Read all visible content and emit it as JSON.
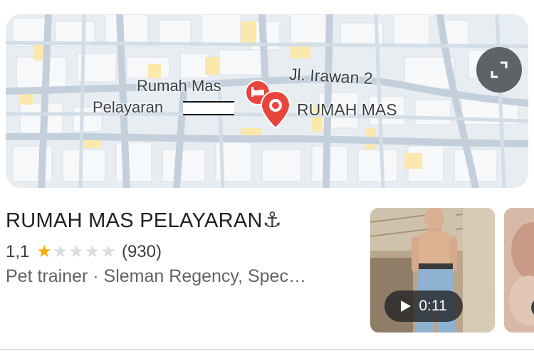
{
  "map": {
    "street_label": "Jl. Irawan 2",
    "poi_label_line1": "Rumah Mas",
    "poi_label_line2": "Pelayaran",
    "pin_label": "RUMAH MAS",
    "expand_icon": "expand-icon",
    "colors": {
      "road": "#c9d6e1",
      "block": "#f6f7f9",
      "highlight": "#fbe9b0",
      "pin": "#e8453c"
    }
  },
  "place": {
    "title": "RUMAH MAS PELAYARAN",
    "title_icon": "⚓",
    "rating": "1,1",
    "rating_value": 1.1,
    "stars_filled": 1,
    "stars_total": 5,
    "review_count": "(930)",
    "category_line": "Pet trainer · Sleman Regency, Spec…"
  },
  "media": {
    "video_duration": "0:11",
    "colors": {
      "star": "#f9ab00",
      "star_empty": "#dadce0"
    }
  }
}
